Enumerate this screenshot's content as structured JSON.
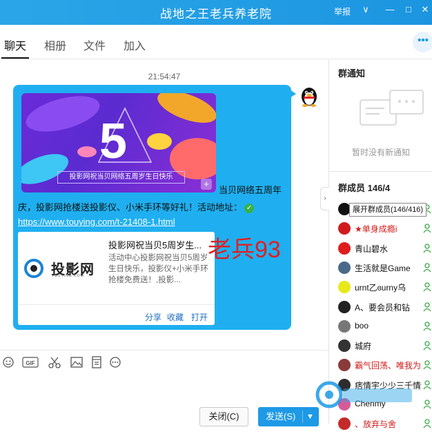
{
  "window": {
    "title": "战地之王老兵养老院",
    "report_label": "举报",
    "controls": {
      "dropdown": "∨",
      "minimize": "—",
      "maximize": "□",
      "close": "✕"
    }
  },
  "tabs": [
    {
      "label": "聊天",
      "active": true
    },
    {
      "label": "相册",
      "active": false
    },
    {
      "label": "文件",
      "active": false
    },
    {
      "label": "加入",
      "active": false
    }
  ],
  "more_label": "•••",
  "chat": {
    "timestamp": "21:54:47",
    "banner": {
      "caption": "投影网祝当贝网络五周岁生日快乐",
      "big_number": "5",
      "plus": "+"
    },
    "message_lines": [
      "当贝网络五周年",
      "庆，投影网抢楼送投影仪、小米手环等好礼！活动地址："
    ],
    "check_mark": "✓",
    "link": "https://www.touying.com/t-21408-1.html",
    "card": {
      "title": "投影网祝当贝5周岁生...",
      "description": "活动中心投影网祝当贝5周岁生日快乐，投影仪+小米手环抢楼免费送！,投影...",
      "logo_text": "投影网",
      "logo_sub": "TOUYING.COM",
      "actions": [
        "分享",
        "收藏",
        "打开"
      ]
    },
    "overlay_text": "老兵93"
  },
  "toolbar_icons": [
    "emoji-icon",
    "gif-icon",
    "scissors-icon",
    "image-icon",
    "document-icon",
    "more-icon"
  ],
  "toolbar_gif": "GIF",
  "buttons": {
    "close": "关闭(C)",
    "send": "发送(S)",
    "send_arrow": "▼"
  },
  "right_panel": {
    "notice_title": "群通知",
    "notice_empty": "暂时没有新通知",
    "members_title": "群成员 146/4",
    "tooltip": "展开群成员(146/416)",
    "collapse": "›",
    "members": [
      {
        "name": "",
        "color": "#111111",
        "name_color": "#111111"
      },
      {
        "name": "★单身成瘾i",
        "color": "#d11b1b",
        "name_color": "#d11b1b"
      },
      {
        "name": "青山碧水",
        "color": "#e01c1c",
        "name_color": "#111111"
      },
      {
        "name": "生活就是Game",
        "color": "#4a6a8a",
        "name_color": "#111111"
      },
      {
        "name": "urnt乙ɞurny乌",
        "color": "#e8e81a",
        "name_color": "#111111"
      },
      {
        "name": "A、要会员和钻",
        "color": "#222222",
        "name_color": "#111111"
      },
      {
        "name": "boo",
        "color": "#777777",
        "name_color": "#111111"
      },
      {
        "name": "城府",
        "color": "#333333",
        "name_color": "#111111"
      },
      {
        "name": "霸气回荡、唯我为王",
        "color": "#8a3a3a",
        "name_color": "#d11b1b"
      },
      {
        "name": "痞情宇少少三千情无",
        "color": "#2d2d2d",
        "name_color": "#111111"
      },
      {
        "name": "Chenmy",
        "color": "#d65a9a",
        "name_color": "#111111"
      },
      {
        "name": "、放弃与舍",
        "color": "#c42a2a",
        "name_color": "#d11b1b"
      }
    ]
  },
  "colors": {
    "accent": "#1d99e6",
    "bubble": "#1faff0",
    "owner_red": "#d11b1b",
    "role_green": "#3aa845"
  }
}
